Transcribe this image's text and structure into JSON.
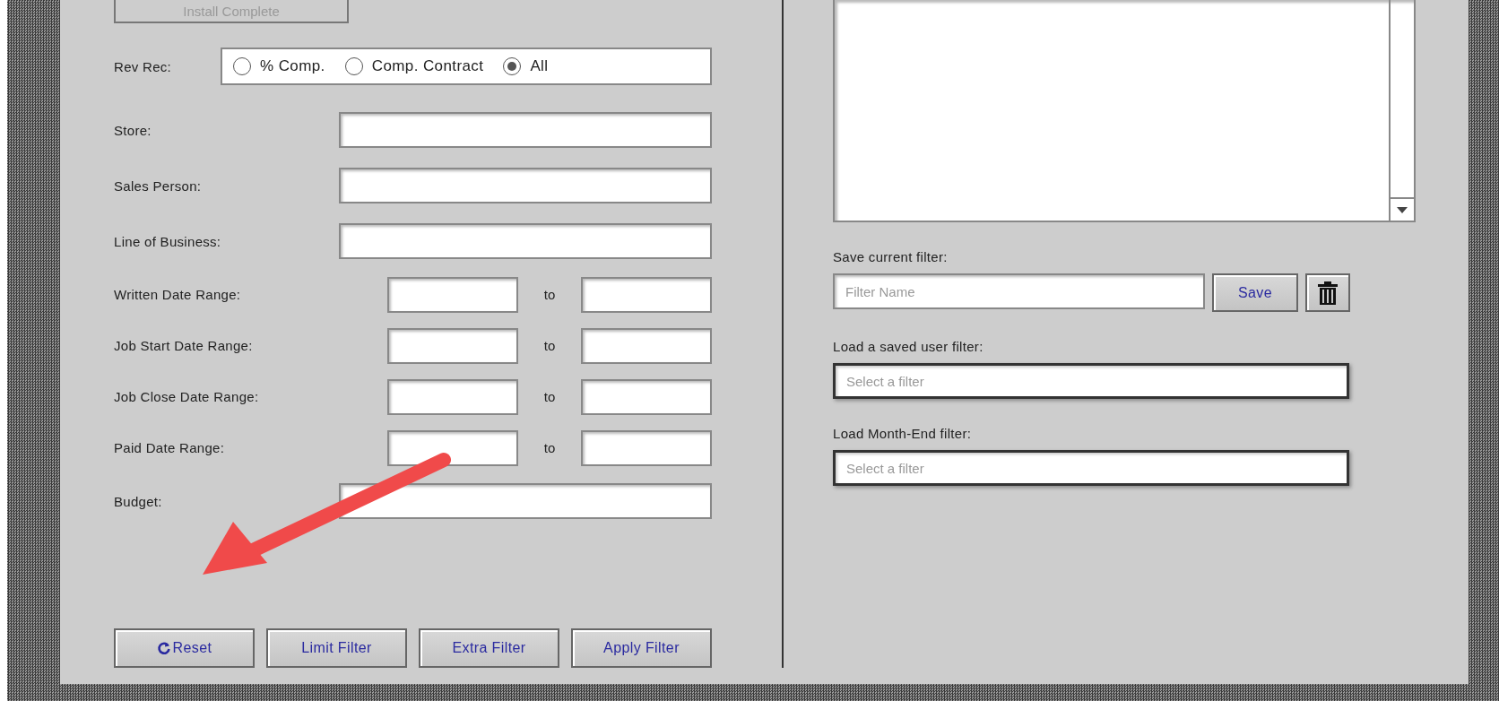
{
  "top_button": {
    "label": "Install Complete",
    "disabled": true
  },
  "rev_rec": {
    "label": "Rev Rec:",
    "options": [
      {
        "label": "% Comp.",
        "selected": false
      },
      {
        "label": "Comp. Contract",
        "selected": false
      },
      {
        "label": "All",
        "selected": true
      }
    ]
  },
  "fields": [
    {
      "kind": "text",
      "label": "Store:"
    },
    {
      "kind": "text",
      "label": "Sales Person:"
    },
    {
      "kind": "text",
      "label": "Line of Business:"
    },
    {
      "kind": "range",
      "label": "Written Date Range:",
      "separator": "to"
    },
    {
      "kind": "range",
      "label": "Job Start Date Range:",
      "separator": "to"
    },
    {
      "kind": "range",
      "label": "Job Close Date Range:",
      "separator": "to"
    },
    {
      "kind": "range",
      "label": "Paid Date Range:",
      "separator": "to"
    },
    {
      "kind": "text",
      "label": "Budget:"
    }
  ],
  "buttons": [
    {
      "label": "Reset",
      "kind": "reset"
    },
    {
      "label": "Limit Filter",
      "kind": "plain"
    },
    {
      "label": "Extra Filter",
      "kind": "plain"
    },
    {
      "label": "Apply Filter",
      "kind": "plain"
    }
  ],
  "save_filter": {
    "label": "Save current filter:",
    "placeholder": "Filter Name",
    "button": "Save"
  },
  "load_user_filter": {
    "label": "Load a saved user filter:",
    "placeholder": "Select a filter"
  },
  "load_month_end_filter": {
    "label": "Load Month-End filter:",
    "placeholder": "Select a filter"
  }
}
